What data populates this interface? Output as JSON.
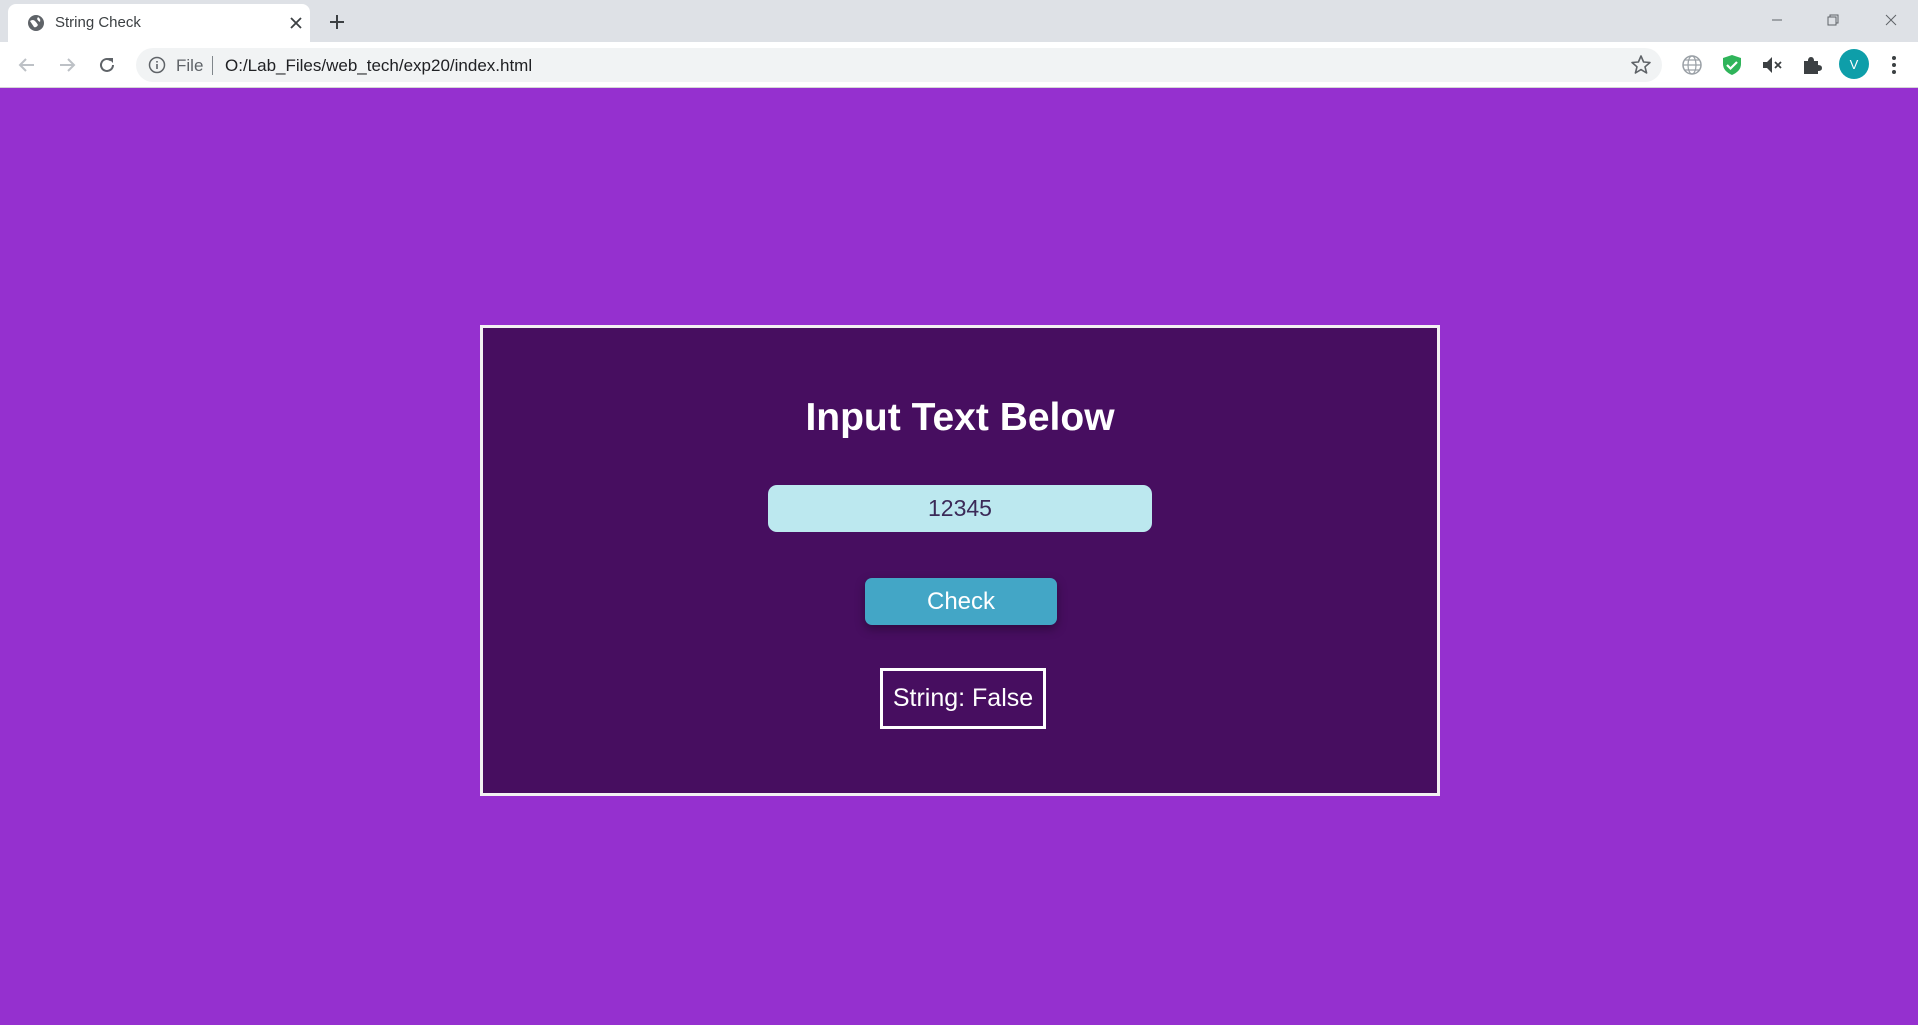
{
  "browser": {
    "tab_title": "String Check",
    "address_scheme_label": "File",
    "url": "O:/Lab_Files/web_tech/exp20/index.html",
    "profile_initial": "V"
  },
  "page": {
    "heading": "Input Text Below",
    "input_value": "12345",
    "check_button_label": "Check",
    "result_text": "String: False"
  },
  "colors": {
    "page_background": "#9530cf",
    "card_background": "#470e60",
    "input_background": "#bce8ef",
    "button_background": "#43a6c6"
  },
  "icons": [
    "globe-icon",
    "close-icon",
    "plus-icon",
    "back-icon",
    "forward-icon",
    "reload-icon",
    "info-icon",
    "star-icon",
    "translate-icon",
    "shield-icon",
    "mute-icon",
    "puzzle-icon",
    "menu-icon"
  ]
}
